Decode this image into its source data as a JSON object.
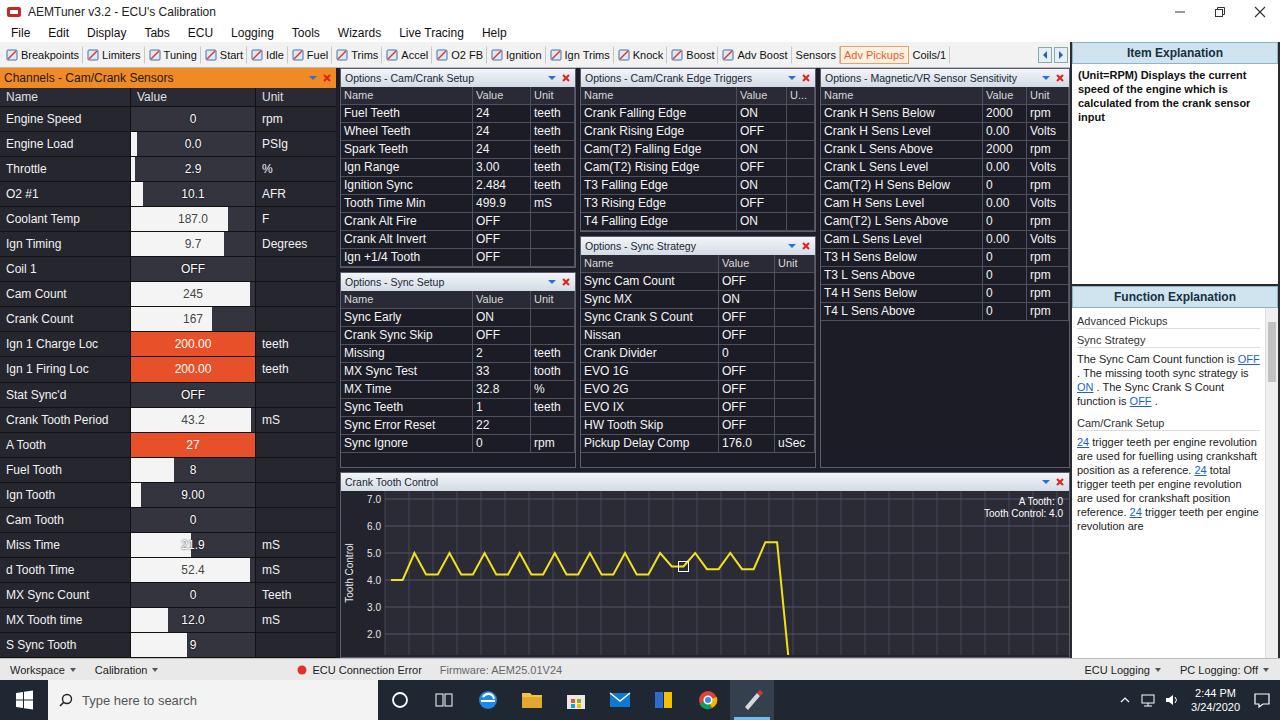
{
  "window": {
    "title": "AEMTuner v3.2 - ECU's Calibration"
  },
  "menu": [
    "File",
    "Edit",
    "Display",
    "Tabs",
    "ECU",
    "Logging",
    "Tools",
    "Wizards",
    "Live Tracing",
    "Help"
  ],
  "tabs": [
    {
      "label": "Breakpoints",
      "selected": false,
      "icon": true
    },
    {
      "label": "Limiters",
      "selected": false,
      "icon": true
    },
    {
      "label": "Tuning",
      "selected": false,
      "icon": true
    },
    {
      "label": "Start",
      "selected": false,
      "icon": true
    },
    {
      "label": "Idle",
      "selected": false,
      "icon": true
    },
    {
      "label": "Fuel",
      "selected": false,
      "icon": true
    },
    {
      "label": "Trims",
      "selected": false,
      "icon": true
    },
    {
      "label": "Accel",
      "selected": false,
      "icon": true
    },
    {
      "label": "O2 FB",
      "selected": false,
      "icon": true
    },
    {
      "label": "Ignition",
      "selected": false,
      "icon": true
    },
    {
      "label": "Ign Trims",
      "selected": false,
      "icon": true
    },
    {
      "label": "Knock",
      "selected": false,
      "icon": true
    },
    {
      "label": "Boost",
      "selected": false,
      "icon": true
    },
    {
      "label": "Adv Boost",
      "selected": false,
      "icon": true
    },
    {
      "label": "Sensors",
      "selected": false,
      "icon": false
    },
    {
      "label": "Adv Pickups",
      "selected": true,
      "icon": false
    },
    {
      "label": "Coils/1",
      "selected": false,
      "icon": false
    }
  ],
  "channels": {
    "title": "Channels - Cam/Crank Sensors",
    "columns": [
      "Name",
      "Value",
      "Unit"
    ],
    "rows": [
      {
        "name": "Engine Speed",
        "value": "0",
        "unit": "rpm",
        "level": 0,
        "alarm": false
      },
      {
        "name": "Engine Load",
        "value": "0.0",
        "unit": "PSIg",
        "level": 0.05,
        "alarm": false
      },
      {
        "name": "Throttle",
        "value": "2.9",
        "unit": "%",
        "level": 0.03,
        "alarm": false
      },
      {
        "name": "O2 #1",
        "value": "10.1",
        "unit": "AFR",
        "level": 0.1,
        "alarm": false
      },
      {
        "name": "Coolant Temp",
        "value": "187.0",
        "unit": "F",
        "level": 0.78,
        "alarm": false
      },
      {
        "name": "Ign Timing",
        "value": "9.7",
        "unit": "Degrees",
        "level": 0.75,
        "alarm": false
      },
      {
        "name": "Coil 1",
        "value": "OFF",
        "unit": "",
        "level": 0,
        "alarm": false
      },
      {
        "name": "Cam Count",
        "value": "245",
        "unit": "",
        "level": 0.96,
        "alarm": false
      },
      {
        "name": "Crank Count",
        "value": "167",
        "unit": "",
        "level": 0.65,
        "alarm": false
      },
      {
        "name": "Ign 1 Charge Loc",
        "value": "200.00",
        "unit": "teeth",
        "level": 1,
        "alarm": true
      },
      {
        "name": "Ign 1 Firing Loc",
        "value": "200.00",
        "unit": "teeth",
        "level": 1,
        "alarm": true
      },
      {
        "name": "Stat Sync'd",
        "value": "OFF",
        "unit": "",
        "level": 0,
        "alarm": false
      },
      {
        "name": "Crank Tooth Period",
        "value": "43.2",
        "unit": "mS",
        "level": 0.97,
        "alarm": false
      },
      {
        "name": "A Tooth",
        "value": "27",
        "unit": "",
        "level": 1,
        "alarm": true
      },
      {
        "name": "Fuel Tooth",
        "value": "8",
        "unit": "",
        "level": 0.35,
        "alarm": false
      },
      {
        "name": "Ign Tooth",
        "value": "9.00",
        "unit": "",
        "level": 0.08,
        "alarm": false
      },
      {
        "name": "Cam Tooth",
        "value": "0",
        "unit": "",
        "level": 0,
        "alarm": false
      },
      {
        "name": "Miss Time",
        "value": "21.9",
        "unit": "mS",
        "level": 0.48,
        "alarm": false
      },
      {
        "name": "d Tooth Time",
        "value": "52.4",
        "unit": "mS",
        "level": 0.96,
        "alarm": false
      },
      {
        "name": "MX Sync Count",
        "value": "0",
        "unit": "Teeth",
        "level": 0,
        "alarm": false
      },
      {
        "name": "MX Tooth time",
        "value": "12.0",
        "unit": "mS",
        "level": 0.3,
        "alarm": false
      },
      {
        "name": "S Sync Tooth",
        "value": "9",
        "unit": "",
        "level": 0.45,
        "alarm": false
      }
    ]
  },
  "cam_crank_setup": {
    "title": "Options - Cam/Crank Setup",
    "columns": [
      "Name",
      "Value",
      "Unit"
    ],
    "rows": [
      {
        "name": "Fuel Teeth",
        "value": "24",
        "unit": "teeth"
      },
      {
        "name": "Wheel Teeth",
        "value": "24",
        "unit": "teeth"
      },
      {
        "name": "Spark Teeth",
        "value": "24",
        "unit": "teeth"
      },
      {
        "name": "Ign Range",
        "value": "3.00",
        "unit": "teeth"
      },
      {
        "name": "Ignition Sync",
        "value": "2.484",
        "unit": "teeth"
      },
      {
        "name": "Tooth Time Min",
        "value": "499.9",
        "unit": "mS"
      },
      {
        "name": "Crank Alt Fire",
        "value": "OFF",
        "unit": ""
      },
      {
        "name": "Crank Alt Invert",
        "value": "OFF",
        "unit": ""
      },
      {
        "name": "Ign +1/4 Tooth",
        "value": "OFF",
        "unit": ""
      }
    ]
  },
  "sync_setup": {
    "title": "Options - Sync Setup",
    "columns": [
      "Name",
      "Value",
      "Unit"
    ],
    "rows": [
      {
        "name": "Sync Early",
        "value": "ON",
        "unit": ""
      },
      {
        "name": "Crank Sync Skip",
        "value": "OFF",
        "unit": ""
      },
      {
        "name": "Missing",
        "value": "2",
        "unit": "teeth"
      },
      {
        "name": "MX Sync Test",
        "value": "33",
        "unit": "tooth"
      },
      {
        "name": "MX Time",
        "value": "32.8",
        "unit": "%"
      },
      {
        "name": "Sync Teeth",
        "value": "1",
        "unit": "teeth"
      },
      {
        "name": "Sync Error Reset",
        "value": "22",
        "unit": ""
      },
      {
        "name": "Sync Ignore",
        "value": "0",
        "unit": "rpm"
      }
    ]
  },
  "edge_triggers": {
    "title": "Options - Cam/Crank Edge Triggers",
    "columns": [
      "Name",
      "Value",
      "U..."
    ],
    "rows": [
      {
        "name": "Crank Falling Edge",
        "value": "ON",
        "unit": ""
      },
      {
        "name": "Crank Rising Edge",
        "value": "OFF",
        "unit": ""
      },
      {
        "name": "Cam(T2) Falling Edge",
        "value": "ON",
        "unit": ""
      },
      {
        "name": "Cam(T2) Rising Edge",
        "value": "OFF",
        "unit": ""
      },
      {
        "name": "T3 Falling Edge",
        "value": "ON",
        "unit": ""
      },
      {
        "name": "T3 Rising Edge",
        "value": "OFF",
        "unit": ""
      },
      {
        "name": "T4 Falling Edge",
        "value": "ON",
        "unit": ""
      }
    ]
  },
  "sync_strategy": {
    "title": "Options - Sync Strategy",
    "columns": [
      "Name",
      "Value",
      "Unit"
    ],
    "rows": [
      {
        "name": "Sync Cam Count",
        "value": "OFF",
        "unit": ""
      },
      {
        "name": "Sync MX",
        "value": "ON",
        "unit": ""
      },
      {
        "name": "Sync Crank S Count",
        "value": "OFF",
        "unit": ""
      },
      {
        "name": "Nissan",
        "value": "OFF",
        "unit": ""
      },
      {
        "name": "Crank Divider",
        "value": "0",
        "unit": ""
      },
      {
        "name": "EVO 1G",
        "value": "OFF",
        "unit": ""
      },
      {
        "name": "EVO 2G",
        "value": "OFF",
        "unit": ""
      },
      {
        "name": "EVO IX",
        "value": "OFF",
        "unit": ""
      },
      {
        "name": "HW Tooth Skip",
        "value": "OFF",
        "unit": ""
      },
      {
        "name": "Pickup Delay Comp",
        "value": "176.0",
        "unit": "uSec"
      }
    ]
  },
  "sensor_sensitivity": {
    "title": "Options - Magnetic/VR Sensor Sensitivity",
    "columns": [
      "Name",
      "Value",
      "Unit"
    ],
    "rows": [
      {
        "name": "Crank H Sens Below",
        "value": "2000",
        "unit": "rpm"
      },
      {
        "name": "Crank H Sens Level",
        "value": "0.00",
        "unit": "Volts"
      },
      {
        "name": "Crank L Sens Above",
        "value": "2000",
        "unit": "rpm"
      },
      {
        "name": "Crank L Sens Level",
        "value": "0.00",
        "unit": "Volts"
      },
      {
        "name": "Cam(T2) H Sens Below",
        "value": "0",
        "unit": "rpm"
      },
      {
        "name": "Cam H Sens Level",
        "value": "0.00",
        "unit": "Volts"
      },
      {
        "name": "Cam(T2) L Sens Above",
        "value": "0",
        "unit": "rpm"
      },
      {
        "name": "Cam L Sens Level",
        "value": "0.00",
        "unit": "Volts"
      },
      {
        "name": "T3 H Sens Below",
        "value": "0",
        "unit": "rpm"
      },
      {
        "name": "T3 L Sens Above",
        "value": "0",
        "unit": "rpm"
      },
      {
        "name": "T4 H Sens Below",
        "value": "0",
        "unit": "rpm"
      },
      {
        "name": "T4 L Sens Above",
        "value": "0",
        "unit": "rpm"
      }
    ]
  },
  "chart": {
    "title": "Crank Tooth Control",
    "y_label": "Tooth Control",
    "y_ticks": [
      "7.0",
      "6.0",
      "5.0",
      "4.0",
      "3.0",
      "2.0"
    ],
    "legend": [
      "A Tooth: 0",
      "Tooth Control: 4.0"
    ],
    "series": [
      {
        "values": [
          4.0,
          4.0,
          5.0,
          4.2,
          4.2,
          5.0,
          4.2,
          4.2,
          5.0,
          4.2,
          4.2,
          5.0,
          4.2,
          4.2,
          5.0,
          4.2,
          4.2,
          5.0,
          4.2,
          4.2,
          5.0,
          4.2,
          4.2,
          5.0,
          4.5,
          4.5,
          5.0,
          4.4,
          4.4,
          5.0,
          4.4,
          4.4,
          5.4,
          5.4,
          1.0
        ]
      }
    ],
    "cursor_index": 25
  },
  "item_explanation": {
    "title": "Item Explanation",
    "text": "(Unit=RPM) Displays the current speed of the engine which is calculated from the crank sensor input"
  },
  "function_explanation": {
    "title": "Function Explanation",
    "blocks": [
      {
        "kind": "heading",
        "text": "Advanced Pickups"
      },
      {
        "kind": "heading",
        "text": "Sync Strategy"
      },
      {
        "kind": "paragraph",
        "segments": [
          {
            "text": "The Sync Cam Count function is ",
            "link": false
          },
          {
            "text": "OFF",
            "link": true
          },
          {
            "text": " . The missing tooth sync strategy is ",
            "link": false
          },
          {
            "text": "ON",
            "link": true
          },
          {
            "text": " . The Sync Crank S Count function is ",
            "link": false
          },
          {
            "text": "OFF",
            "link": true
          },
          {
            "text": " .",
            "link": false
          }
        ]
      },
      {
        "kind": "heading",
        "text": "Cam/Crank Setup"
      },
      {
        "kind": "paragraph",
        "segments": [
          {
            "text": "24",
            "link": true
          },
          {
            "text": " trigger teeth per engine revolution are used for fuelling using crankshaft position as a reference. ",
            "link": false
          },
          {
            "text": "24",
            "link": true
          },
          {
            "text": " total trigger teeth per engine revolution are used for crankshaft position reference. ",
            "link": false
          },
          {
            "text": "24",
            "link": true
          },
          {
            "text": " trigger teeth per engine revolution are",
            "link": false
          }
        ]
      }
    ]
  },
  "status_bar": {
    "workspace": "Workspace",
    "calibration": "Calibration",
    "connection": "ECU Connection Error",
    "firmware": "Firmware: AEM25.01V24",
    "ecu_logging": "ECU Logging",
    "pc_logging": "PC Logging: Off"
  },
  "taskbar": {
    "search_placeholder": "Type here to search",
    "time": "2:44 PM",
    "date": "3/24/2020"
  }
}
